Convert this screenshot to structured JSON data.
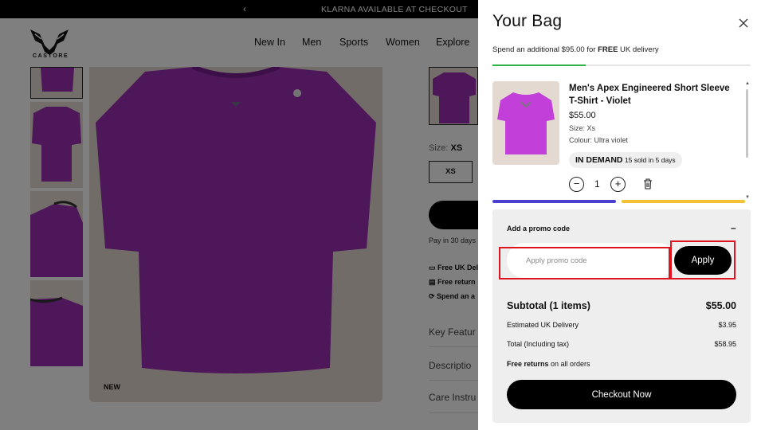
{
  "announcement": {
    "message": "KLARNA AVAILABLE AT CHECKOUT"
  },
  "brand": {
    "logo_text": "CASTORE"
  },
  "nav": {
    "items": [
      "New In",
      "Men",
      "Sports",
      "Women",
      "Explore"
    ]
  },
  "product": {
    "badge": "NEW",
    "size_prefix": "Size:",
    "size_selected": "XS",
    "size_option": "XS",
    "pay_text": "Pay in 30 days",
    "features": [
      "Free UK Del",
      "Free return",
      "Spend an a"
    ],
    "accordions": [
      "Key Featur",
      "Descriptio",
      "Care Instru"
    ]
  },
  "bag": {
    "title": "Your Bag",
    "delivery_prefix": "Spend an additional $95.00 for ",
    "delivery_bold": "FREE",
    "delivery_suffix": " UK delivery",
    "progress_fraction": 0.36,
    "item": {
      "name": "Men's Apex Engineered Short Sleeve T-Shirt - Violet",
      "price": "$55.00",
      "size": "Size: Xs",
      "colour": "Colour: Ultra violet",
      "demand_label": "IN DEMAND",
      "demand_text": "15 sold in 5 days",
      "quantity": "1"
    },
    "promo": {
      "title": "Add a promo code",
      "toggle": "–",
      "placeholder": "Apply promo code",
      "apply_label": "Apply"
    },
    "summary": {
      "subtotal_label": "Subtotal (1 items)",
      "subtotal_value": "$55.00",
      "delivery_label": "Estimated UK Delivery",
      "delivery_value": "$3.95",
      "total_label": "Total (Including tax)",
      "total_value": "$58.95",
      "returns_bold": "Free returns",
      "returns_text": " on all orders"
    },
    "checkout_label": "Checkout Now"
  },
  "colors": {
    "accent_green": "#2fb344",
    "highlight_red": "#e0141e",
    "shirt_violet": "#9a2fb5"
  }
}
